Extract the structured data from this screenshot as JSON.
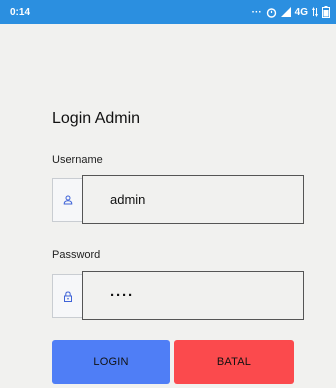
{
  "status_bar": {
    "time": "0:14",
    "network": "4G",
    "color": "#2b8fe0"
  },
  "form": {
    "title": "Login Admin",
    "username_label": "Username",
    "username_value": "admin",
    "username_icon": "user-icon",
    "password_label": "Password",
    "password_value": "····",
    "password_icon": "lock-icon"
  },
  "buttons": {
    "login_label": "LOGIN",
    "login_color": "#4f7ef6",
    "cancel_label": "BATAL",
    "cancel_color": "#fb4a4d"
  }
}
